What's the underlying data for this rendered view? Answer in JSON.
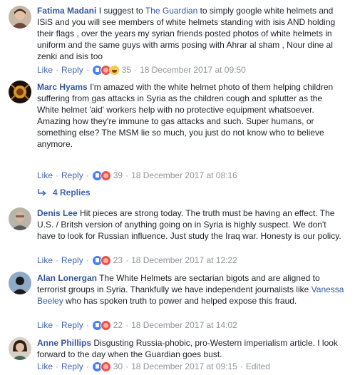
{
  "comments": [
    {
      "author": "Fatima Madani",
      "text_before_link": "I suggest to ",
      "link": "The Guardian",
      "text_after_link": " to simply google white helmets and ISiS and you will see members of white helmets standing with isis AND holding their flags , over the years my syrian friends posted photos of white helmets in uniform and the same guys with arms posing with Ahrar al sham , Nour dine al zenki and isis too",
      "like": "Like",
      "reply": "Reply",
      "reactions": [
        "like-icon",
        "angry-icon",
        "haha-icon"
      ],
      "count": "35",
      "timestamp": "18 December 2017 at 09:50"
    },
    {
      "author": "Marc Hyams",
      "text": "I'm amazed with the white helmet photo of them helping children suffering from gas attacks in Syria as the children cough and splutter as the White helmet 'aid' workers help with no protective equipment whatsoever. Amazing how they're immune to gas attacks and such. Super humans, or something else? The MSM lie so much, you just do not know who to believe anymore.",
      "like": "Like",
      "reply": "Reply",
      "reactions": [
        "like-icon",
        "angry-icon"
      ],
      "count": "39",
      "timestamp": "18 December 2017 at 08:16",
      "replies_label": "4 Replies"
    },
    {
      "author": "Denis Lee",
      "text": "Hit pieces are strong today. The truth must be having an effect. The U.S. / Britsh version of anything going on in Syria is highly suspect. We don't have to look for Russian influence. Just study the Iraq war. Honesty is our policy.",
      "like": "Like",
      "reply": "Reply",
      "reactions": [
        "like-icon",
        "angry-icon"
      ],
      "count": "23",
      "timestamp": "18 December 2017 at 12:22"
    },
    {
      "author": "Alan Lonergan",
      "text_before_link": "The White Helmets are sectarian bigots and are aligned to terrorist groups in Syria. Thankfully we have independent journalists like ",
      "link": "Vanessa Beeley",
      "text_after_link": " who has spoken truth to power and helped expose this fraud.",
      "like": "Like",
      "reply": "Reply",
      "reactions": [
        "like-icon",
        "angry-icon"
      ],
      "count": "22",
      "timestamp": "18 December 2017 at 14:02"
    },
    {
      "author": "Anne Phillips",
      "text": "Disgusting Russia-phobic, pro-Western imperialism article. I look forward to the day when the Guardian goes bust.",
      "like": "Like",
      "reply": "Reply",
      "reactions": [
        "like-icon",
        "angry-icon"
      ],
      "count": "30",
      "timestamp": "18 December 2017 at 09:15",
      "edited": "Edited"
    }
  ],
  "colors": {
    "link": "#365899",
    "action": "#4267b2",
    "meta": "#90949c",
    "text": "#1d2129"
  }
}
